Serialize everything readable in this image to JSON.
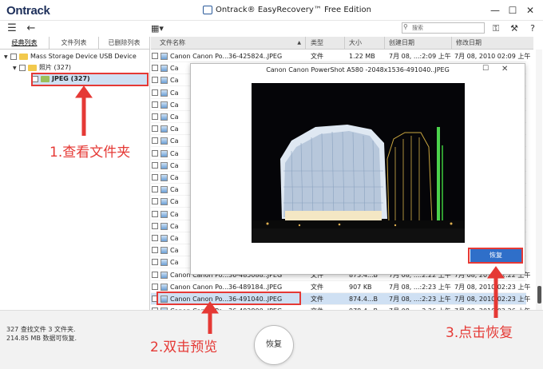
{
  "app": {
    "logo": "Ontrack",
    "title": "Ontrack® EasyRecovery™ Free Edition",
    "search_placeholder": "搜索"
  },
  "left_tabs": [
    "经典列表",
    "文件列表",
    "已删除列表"
  ],
  "tree": [
    {
      "label": "Mass Storage Device USB Device"
    },
    {
      "label": "照片 (327)"
    },
    {
      "label": "JPEG (327)"
    }
  ],
  "columns": [
    "文件名称",
    "类型",
    "大小",
    "创建日期",
    "修改日期"
  ],
  "files": [
    {
      "name": "Canon Canon Po...36-425824..JPEG",
      "type": "文件",
      "size": "1.22 MB",
      "created": "7月 08, ...:2:09 上午",
      "modified": "7月 08, 2010 02:09 上午"
    },
    {
      "name": "Ca"
    },
    {
      "name": "Ca"
    },
    {
      "name": "Ca"
    },
    {
      "name": "Ca"
    },
    {
      "name": "Ca"
    },
    {
      "name": "Ca"
    },
    {
      "name": "Ca"
    },
    {
      "name": "Ca"
    },
    {
      "name": "Ca"
    },
    {
      "name": "Ca"
    },
    {
      "name": "Ca"
    },
    {
      "name": "Ca"
    },
    {
      "name": "Ca"
    },
    {
      "name": "Ca"
    },
    {
      "name": "Ca"
    },
    {
      "name": "Ca"
    },
    {
      "name": "Ca"
    },
    {
      "name": "Canon Canon Po...36-485088..JPEG",
      "type": "文件",
      "size": "873.4...B",
      "created": "7月 08, ...:2:22 上午",
      "modified": "7月 08, 2010 02:22 上午"
    },
    {
      "name": "Canon Canon Po...36-489184..JPEG",
      "type": "文件",
      "size": "907 KB",
      "created": "7月 08, ...:2:23 上午",
      "modified": "7月 08, 2010 02:23 上午"
    },
    {
      "name": "Canon Canon Po...36-491040..JPEG",
      "type": "文件",
      "size": "874.4...B",
      "created": "7月 08, ...:2:23 上午",
      "modified": "7月 08, 2010 02:23 上午"
    },
    {
      "name": "Canon Canon Po...36-492800..JPEG",
      "type": "文件",
      "size": "978.4...B",
      "created": "7月 08, ...:2:26 上午",
      "modified": "7月 08, 2010 02:26 上午"
    }
  ],
  "selected_file_index": 20,
  "preview": {
    "title": "Canon Canon PowerShot A580 -2048x1536-491040..JPEG",
    "restore_label": "恢复"
  },
  "footer": {
    "stat_line1": "327 查找文件 3 文件夹.",
    "stat_line2": "214.85 MB 数据可恢复.",
    "recover_label": "恢复"
  },
  "annotations": {
    "step1": "1.查看文件夹",
    "step2": "2.双击预览",
    "step3": "3.点击恢复"
  },
  "colors": {
    "annotation": "#e53935",
    "accent": "#2f6fc9",
    "selected_row": "#cfe0f3"
  }
}
